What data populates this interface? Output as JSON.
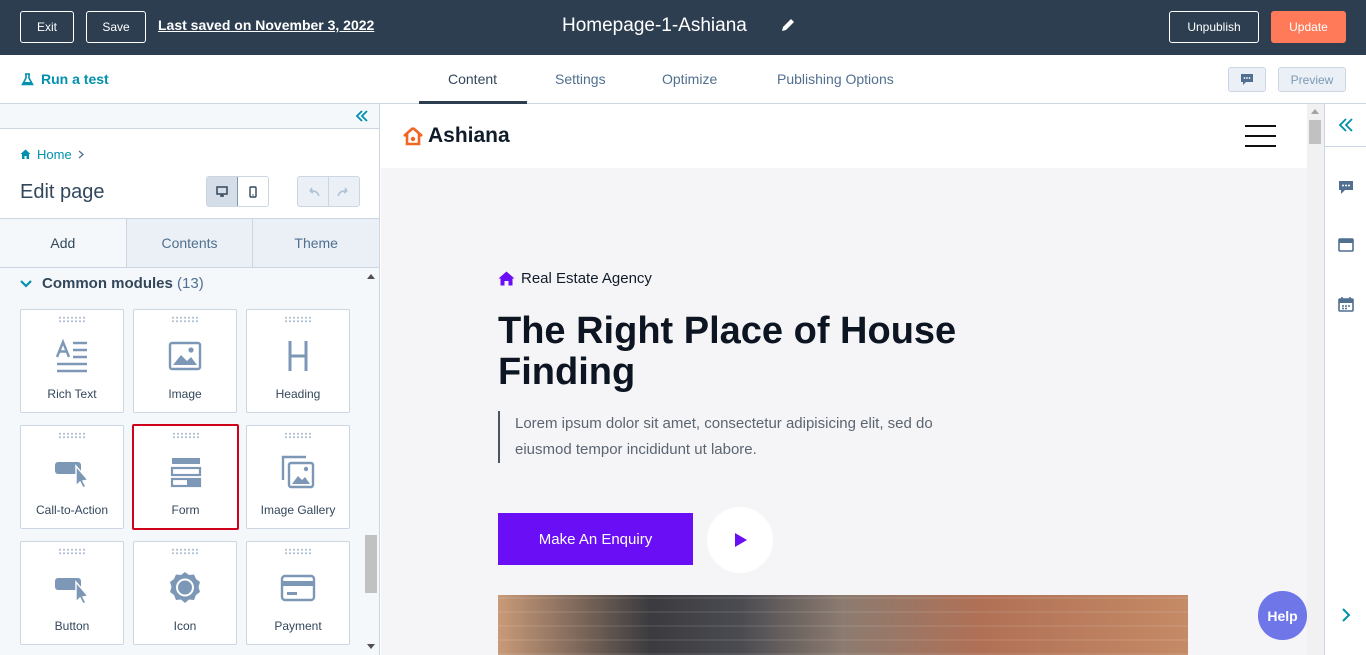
{
  "topbar": {
    "exit_label": "Exit",
    "save_label": "Save",
    "last_saved": "Last saved on November 3, 2022",
    "page_title": "Homepage-1-Ashiana",
    "unpublish_label": "Unpublish",
    "update_label": "Update",
    "colors": {
      "bar": "#2d3e50",
      "update": "#ff7a59"
    }
  },
  "subbar": {
    "run_test": "Run a test",
    "tabs": [
      {
        "label": "Content",
        "active": true
      },
      {
        "label": "Settings",
        "active": false
      },
      {
        "label": "Optimize",
        "active": false
      },
      {
        "label": "Publishing Options",
        "active": false
      }
    ],
    "preview_label": "Preview"
  },
  "sidebar": {
    "breadcrumb": "Home",
    "title": "Edit page",
    "tabs": [
      {
        "label": "Add",
        "active": true
      },
      {
        "label": "Contents",
        "active": false
      },
      {
        "label": "Theme",
        "active": false
      }
    ],
    "section": {
      "title": "Common modules",
      "count": "(13)"
    },
    "modules": [
      {
        "label": "Rich Text",
        "icon": "rich-text-icon"
      },
      {
        "label": "Image",
        "icon": "image-icon"
      },
      {
        "label": "Heading",
        "icon": "heading-icon"
      },
      {
        "label": "Call-to-Action",
        "icon": "cta-icon"
      },
      {
        "label": "Form",
        "icon": "form-icon",
        "highlighted": true
      },
      {
        "label": "Image Gallery",
        "icon": "image-gallery-icon"
      },
      {
        "label": "Button",
        "icon": "button-icon"
      },
      {
        "label": "Icon",
        "icon": "icon-module-icon"
      },
      {
        "label": "Payment",
        "icon": "payment-icon"
      }
    ]
  },
  "preview": {
    "brand": "Ashiana",
    "agency": "Real Estate Agency",
    "headline": "The Right Place of House Finding",
    "body": "Lorem ipsum dolor sit amet, consectetur adipisicing elit, sed do eiusmod tempor incididunt ut labore.",
    "cta_label": "Make An Enquiry",
    "colors": {
      "accent": "#6a0ef5",
      "brand_icon": "#f26522"
    }
  },
  "help_label": "Help"
}
